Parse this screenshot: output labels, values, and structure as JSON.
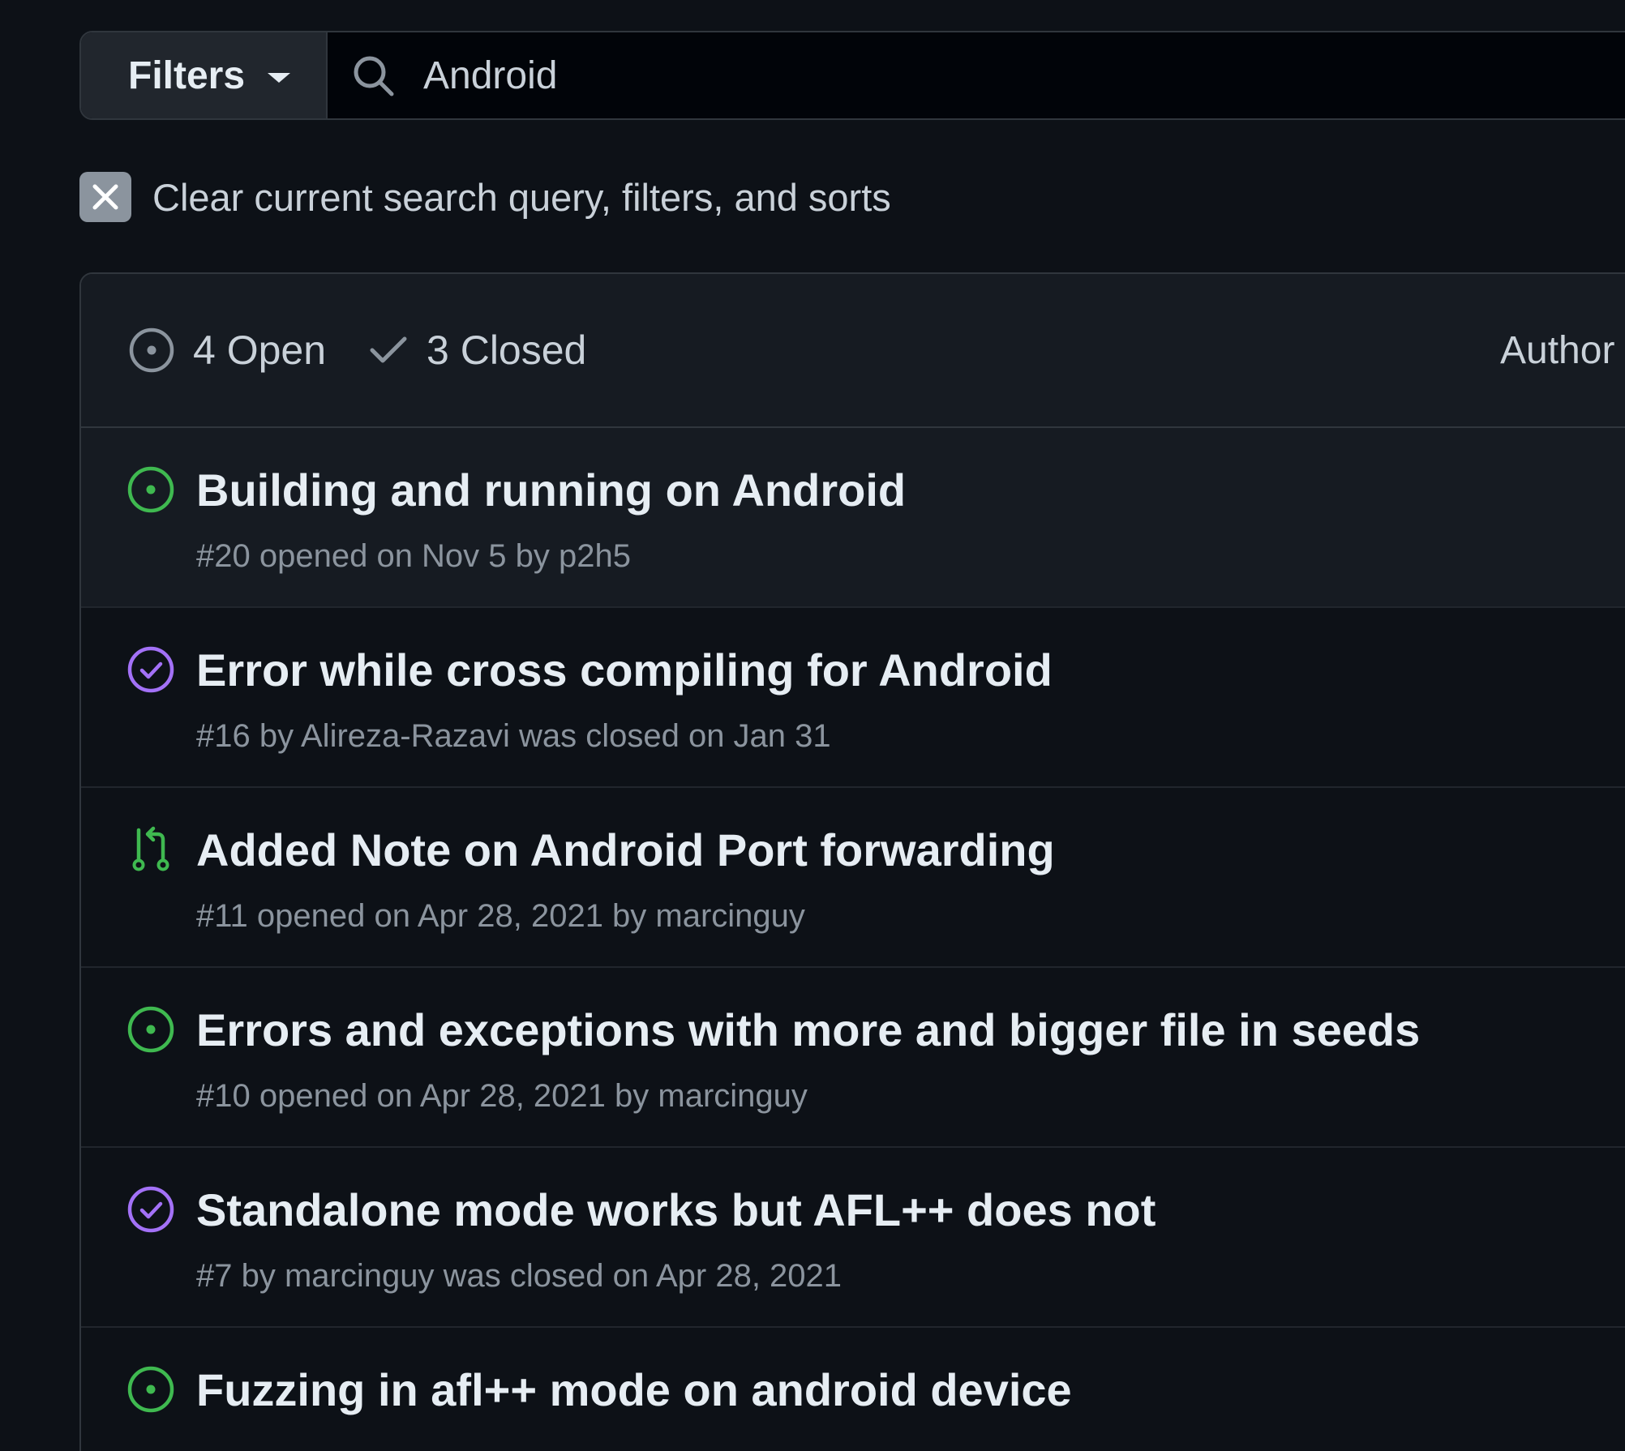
{
  "search": {
    "filters_label": "Filters",
    "query": "Android"
  },
  "clear": {
    "label": "Clear current search query, filters, and sorts"
  },
  "header": {
    "open_label": "4 Open",
    "closed_label": "3 Closed",
    "author_label": "Author"
  },
  "colors": {
    "open": "#3fb950",
    "closed": "#a371f7",
    "pr": "#3fb950"
  },
  "items": [
    {
      "icon": "issue-opened-icon",
      "title": "Building and running on Android",
      "meta": "#20 opened on Nov 5 by p2h5"
    },
    {
      "icon": "issue-closed-icon",
      "title": "Error while cross compiling for Android",
      "meta": "#16 by Alireza-Razavi was closed on Jan 31"
    },
    {
      "icon": "pull-request-icon",
      "title": "Added Note on Android Port forwarding",
      "meta": "#11 opened on Apr 28, 2021 by marcinguy"
    },
    {
      "icon": "issue-opened-icon",
      "title": "Errors and exceptions with more and bigger file in seeds",
      "meta": "#10 opened on Apr 28, 2021 by marcinguy"
    },
    {
      "icon": "issue-closed-icon",
      "title": "Standalone mode works but AFL++ does not",
      "meta": "#7 by marcinguy was closed on Apr 28, 2021"
    },
    {
      "icon": "issue-opened-icon",
      "title": "Fuzzing in afl++ mode on android device",
      "meta": ""
    }
  ]
}
